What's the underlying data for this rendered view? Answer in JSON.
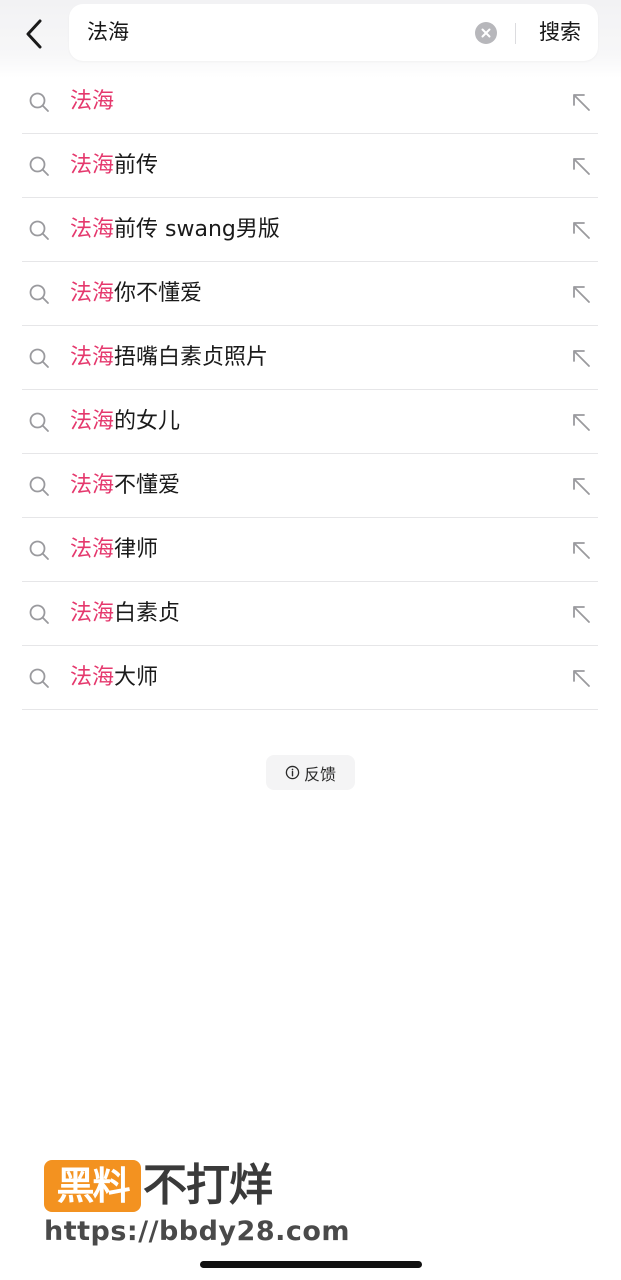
{
  "search": {
    "value": "法海",
    "submit_label": "搜索"
  },
  "suggestions": [
    {
      "highlight": "法海",
      "rest": ""
    },
    {
      "highlight": "法海",
      "rest": "前传"
    },
    {
      "highlight": "法海",
      "rest": "前传 swang男版"
    },
    {
      "highlight": "法海",
      "rest": "你不懂爱"
    },
    {
      "highlight": "法海",
      "rest": "捂嘴白素贞照片"
    },
    {
      "highlight": "法海",
      "rest": "的女儿"
    },
    {
      "highlight": "法海",
      "rest": "不懂爱"
    },
    {
      "highlight": "法海",
      "rest": "律师"
    },
    {
      "highlight": "法海",
      "rest": "白素贞"
    },
    {
      "highlight": "法海",
      "rest": "大师"
    }
  ],
  "feedback": {
    "label": "反馈",
    "icon": "info-icon"
  },
  "watermark": {
    "logo_box": "黑料",
    "logo_text": "不打烊",
    "url": "https://bbdy28.com"
  },
  "icons": {
    "back": "chevron-left-icon",
    "clear": "clear-circle-icon",
    "row": "search-icon",
    "fill": "arrow-up-left-icon"
  },
  "colors": {
    "highlight": "#e5386d",
    "watermark_orange": "#f39220"
  }
}
